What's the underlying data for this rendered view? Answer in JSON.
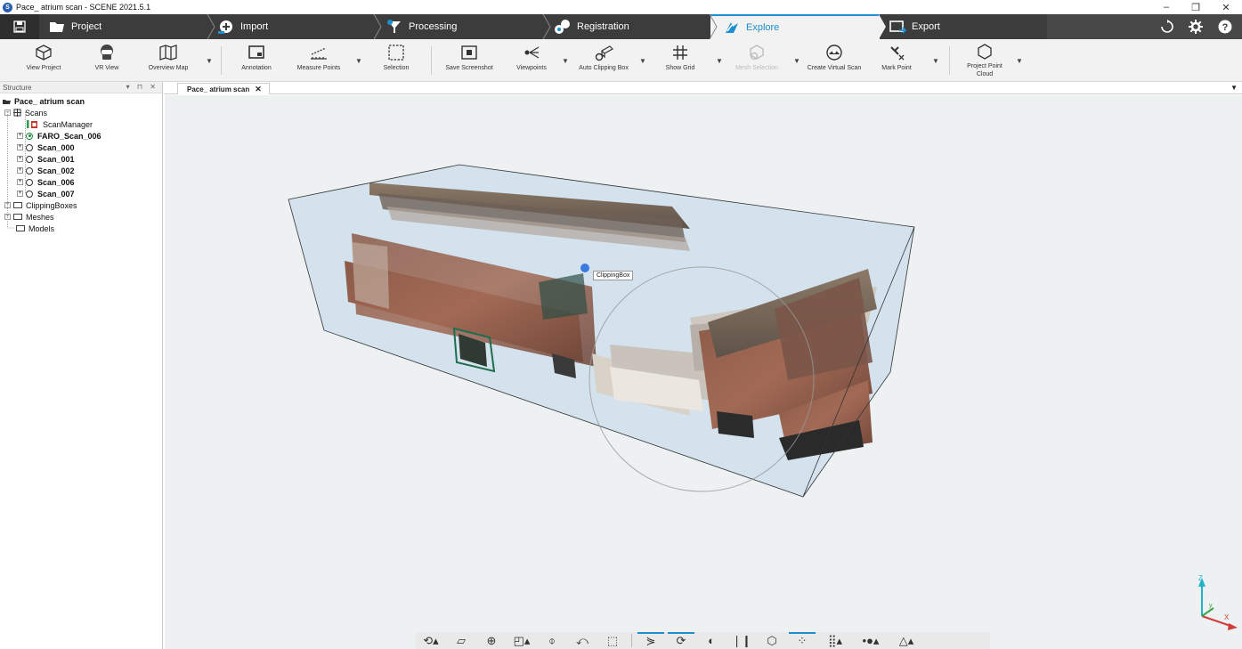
{
  "window": {
    "title": "Pace_ atrium scan - SCENE 2021.5.1",
    "logo_letter": "S",
    "controls": [
      "–",
      "❐",
      "✕"
    ]
  },
  "workflow": {
    "steps": [
      {
        "label": "Project",
        "icon": "folder-icon"
      },
      {
        "label": "Import",
        "icon": "import-icon"
      },
      {
        "label": "Processing",
        "icon": "processing-icon"
      },
      {
        "label": "Registration",
        "icon": "registration-icon"
      },
      {
        "label": "Explore",
        "icon": "explore-icon",
        "active": true
      },
      {
        "label": "Export",
        "icon": "export-icon"
      }
    ],
    "right_icons": [
      "sync-icon",
      "gear-icon",
      "help-icon"
    ],
    "help_glyph": "?",
    "accent": "#1d8ecf"
  },
  "toolbar": {
    "items": [
      {
        "label": "View Project",
        "icon": "cube-icon"
      },
      {
        "label": "VR View",
        "icon": "vr-headset-icon"
      },
      {
        "label": "Overview Map",
        "icon": "map-icon"
      },
      {
        "label": "Annotation",
        "icon": "annotation-icon"
      },
      {
        "label": "Measure Points",
        "icon": "measure-icon"
      },
      {
        "label": "Selection",
        "icon": "selection-icon"
      },
      {
        "label": "Save Screenshot",
        "icon": "screenshot-icon"
      },
      {
        "label": "Viewpoints",
        "icon": "viewpoints-icon"
      },
      {
        "label": "Auto Clipping Box",
        "icon": "clipping-box-icon"
      },
      {
        "label": "Show Grid",
        "icon": "grid-icon"
      },
      {
        "label": "Mesh Selection",
        "icon": "mesh-selection-icon",
        "disabled": true
      },
      {
        "label": "Create Virtual Scan",
        "icon": "virtual-scan-icon"
      },
      {
        "label": "Mark Point",
        "icon": "mark-point-icon"
      },
      {
        "label": "Project Point\nCloud",
        "icon": "project-cloud-icon"
      }
    ]
  },
  "structure": {
    "title": "Structure",
    "header_controls": "▾ ⊓ ✕",
    "tree": [
      {
        "label": "Pace_ atrium scan",
        "bold": true,
        "level": 0,
        "node": "project"
      },
      {
        "label": "Scans",
        "level": 1,
        "node": "scans",
        "exp": "–"
      },
      {
        "label": "ScanManager",
        "level": 3,
        "node": "manager"
      },
      {
        "label": "FARO_Scan_006",
        "bold": true,
        "level": 2,
        "node": "scan-active",
        "exp": "+"
      },
      {
        "label": "Scan_000",
        "bold": true,
        "level": 2,
        "node": "scan",
        "exp": "+"
      },
      {
        "label": "Scan_001",
        "bold": true,
        "level": 2,
        "node": "scan",
        "exp": "+"
      },
      {
        "label": "Scan_002",
        "bold": true,
        "level": 2,
        "node": "scan",
        "exp": "+"
      },
      {
        "label": "Scan_006",
        "bold": true,
        "level": 2,
        "node": "scan",
        "exp": "+"
      },
      {
        "label": "Scan_007",
        "bold": true,
        "level": 2,
        "node": "scan",
        "exp": "+"
      },
      {
        "label": "ClippingBoxes",
        "level": 1,
        "node": "folder",
        "exp": "+"
      },
      {
        "label": "Meshes",
        "level": 1,
        "node": "folder",
        "exp": "+"
      },
      {
        "label": "Models",
        "level": 1,
        "node": "folder"
      }
    ]
  },
  "viewport": {
    "tab_label": "Pace_ atrium scan",
    "tab_close": "✕",
    "menu_glyph": "▼",
    "clipping_label": "ClippingBox",
    "axis_labels": {
      "z": "Z",
      "y": "y",
      "x": "X"
    }
  },
  "bottom_tools": [
    {
      "icon": "orbit-icon",
      "glyph": "⟲▴"
    },
    {
      "icon": "view-box-icon",
      "glyph": "▱"
    },
    {
      "icon": "zoom-icon",
      "glyph": "⊕"
    },
    {
      "icon": "perspective-icon",
      "glyph": "◰▴"
    },
    {
      "icon": "walk-icon",
      "glyph": "⌽"
    },
    {
      "icon": "reset-view-icon",
      "glyph": "⤺"
    },
    {
      "icon": "fit-view-icon",
      "glyph": "⬚"
    },
    {
      "sep": true
    },
    {
      "icon": "clip-plane-icon",
      "glyph": "⋟",
      "highlight": true
    },
    {
      "icon": "clip-box-icon",
      "glyph": "⟳",
      "highlight": true
    },
    {
      "icon": "mirror-icon",
      "glyph": "◐"
    },
    {
      "icon": "slice-icon",
      "glyph": "❘❙"
    },
    {
      "icon": "cube-view-icon",
      "glyph": "⬡"
    },
    {
      "icon": "points-icon",
      "glyph": "⁘",
      "highlight": true
    },
    {
      "icon": "grid-density-icon",
      "glyph": "⣿▴"
    },
    {
      "icon": "point-size-icon",
      "glyph": "•●▴"
    },
    {
      "icon": "filter-icon",
      "glyph": "△▴"
    }
  ]
}
